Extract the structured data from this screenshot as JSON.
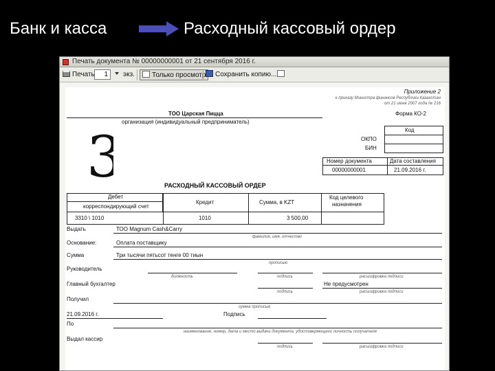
{
  "slide": {
    "left_title": "Банк и касса",
    "right_title": "Расходный кассовый ордер",
    "arrow_color": "#4b4fb8"
  },
  "window": {
    "title": "Печать документа № 00000000001 от 21 сентября 2016 г."
  },
  "toolbar": {
    "print_label": "Печать",
    "copies_value": "1",
    "copies_unit": "экз.",
    "view_only_label": "Только просмотр",
    "save_copy_label": "Сохранить копию..."
  },
  "document": {
    "appendix": "Приложение 2",
    "order_ref_line1": "к приказу Министра финансов Республики Казахстан",
    "order_ref_line2": "от 21 июня 2007 года № 216",
    "org_name": "ТОО Царская Пицца",
    "org_caption": "организация (индивидуальный предприниматель)",
    "form_label": "Форма КО-2",
    "code_header": "Код",
    "okpo_label": "ОКПО",
    "bin_label": "БИН",
    "doc_number_header": "Номер документа",
    "doc_date_header": "Дата составления",
    "doc_number_value": "00000000001",
    "doc_date_value": "21.09.2016 г.",
    "handwritten_mark": "3",
    "order_title": "РАСХОДНЫЙ КАССОВЫЙ ОРДЕР",
    "debit_header": "Дебет",
    "corr_account_header": "корреспондирующий счет",
    "credit_header": "Кредит",
    "amount_header": "Сумма, в KZT",
    "purpose_code_header_line1": "Код целевого",
    "purpose_code_header_line2": "назначения",
    "debit_value": "3310 \\ 1010",
    "credit_value": "1010",
    "amount_value": "3 500,00",
    "issue_label": "Выдать",
    "issue_value": "ТОО Magnum Cash&Carry",
    "issue_caption": "фамилия, имя, отчество",
    "basis_label": "Основание:",
    "basis_value": "Оплата поставщику",
    "sum_label": "Сумма",
    "sum_value": "Три тысячи пятьсот тенге 00 тиын",
    "sum_caption": "прописью",
    "head_label": "Руководитель",
    "position_caption": "должность",
    "signature_caption": "подпись",
    "decoding_caption": "расшифровка подписи",
    "chief_accountant_label": "Главный бухгалтер",
    "chief_accountant_value": "Не предусмотрен",
    "received_label": "Получил",
    "received_caption": "сумма прописью",
    "receipt_date": "21.09.2016 г.",
    "signature_label": "Подпись",
    "by_label": "По",
    "by_caption": "наименование, номер, дата и место выдачи документа, удостоверяющего личность получателя",
    "cashier_label": "Выдал кассир"
  }
}
